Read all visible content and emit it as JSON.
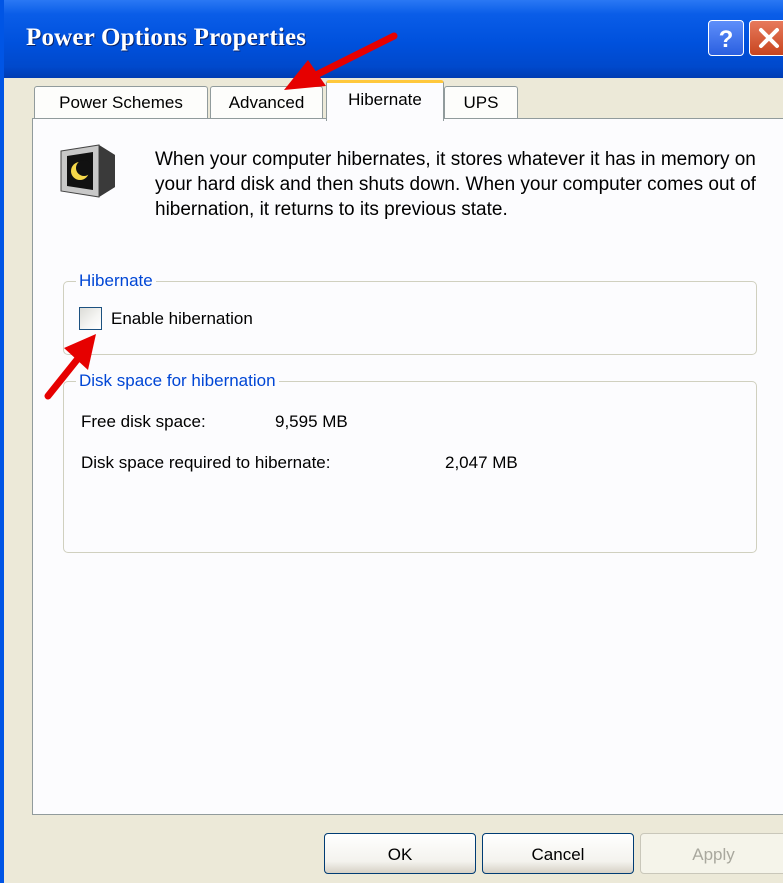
{
  "window": {
    "title": "Power Options Properties",
    "help_label": "?",
    "close_label": "×"
  },
  "tabs": [
    {
      "label": "Power Schemes",
      "selected": false
    },
    {
      "label": "Advanced",
      "selected": false
    },
    {
      "label": "Hibernate",
      "selected": true
    },
    {
      "label": "UPS",
      "selected": false
    }
  ],
  "description": "When your computer hibernates, it stores whatever it has in memory on your hard disk and then shuts down. When your computer comes out of hibernation, it returns to its previous state.",
  "hibernate_group": {
    "title": "Hibernate",
    "checkbox_label": "Enable hibernation",
    "checked": false
  },
  "disk_group": {
    "title": "Disk space for hibernation",
    "free_label": "Free disk space:",
    "free_value": "9,595 MB",
    "required_label": "Disk space required to hibernate:",
    "required_value": "2,047 MB"
  },
  "buttons": {
    "ok": "OK",
    "cancel": "Cancel",
    "apply": "Apply"
  },
  "icons": {
    "monitor": "monitor-moon-icon",
    "annotation": "red-arrow-icon"
  },
  "colors": {
    "titlebar": "#0051dd",
    "group_label": "#0046d5",
    "tab_highlight": "#ffc83c",
    "arrow": "#e60000"
  }
}
